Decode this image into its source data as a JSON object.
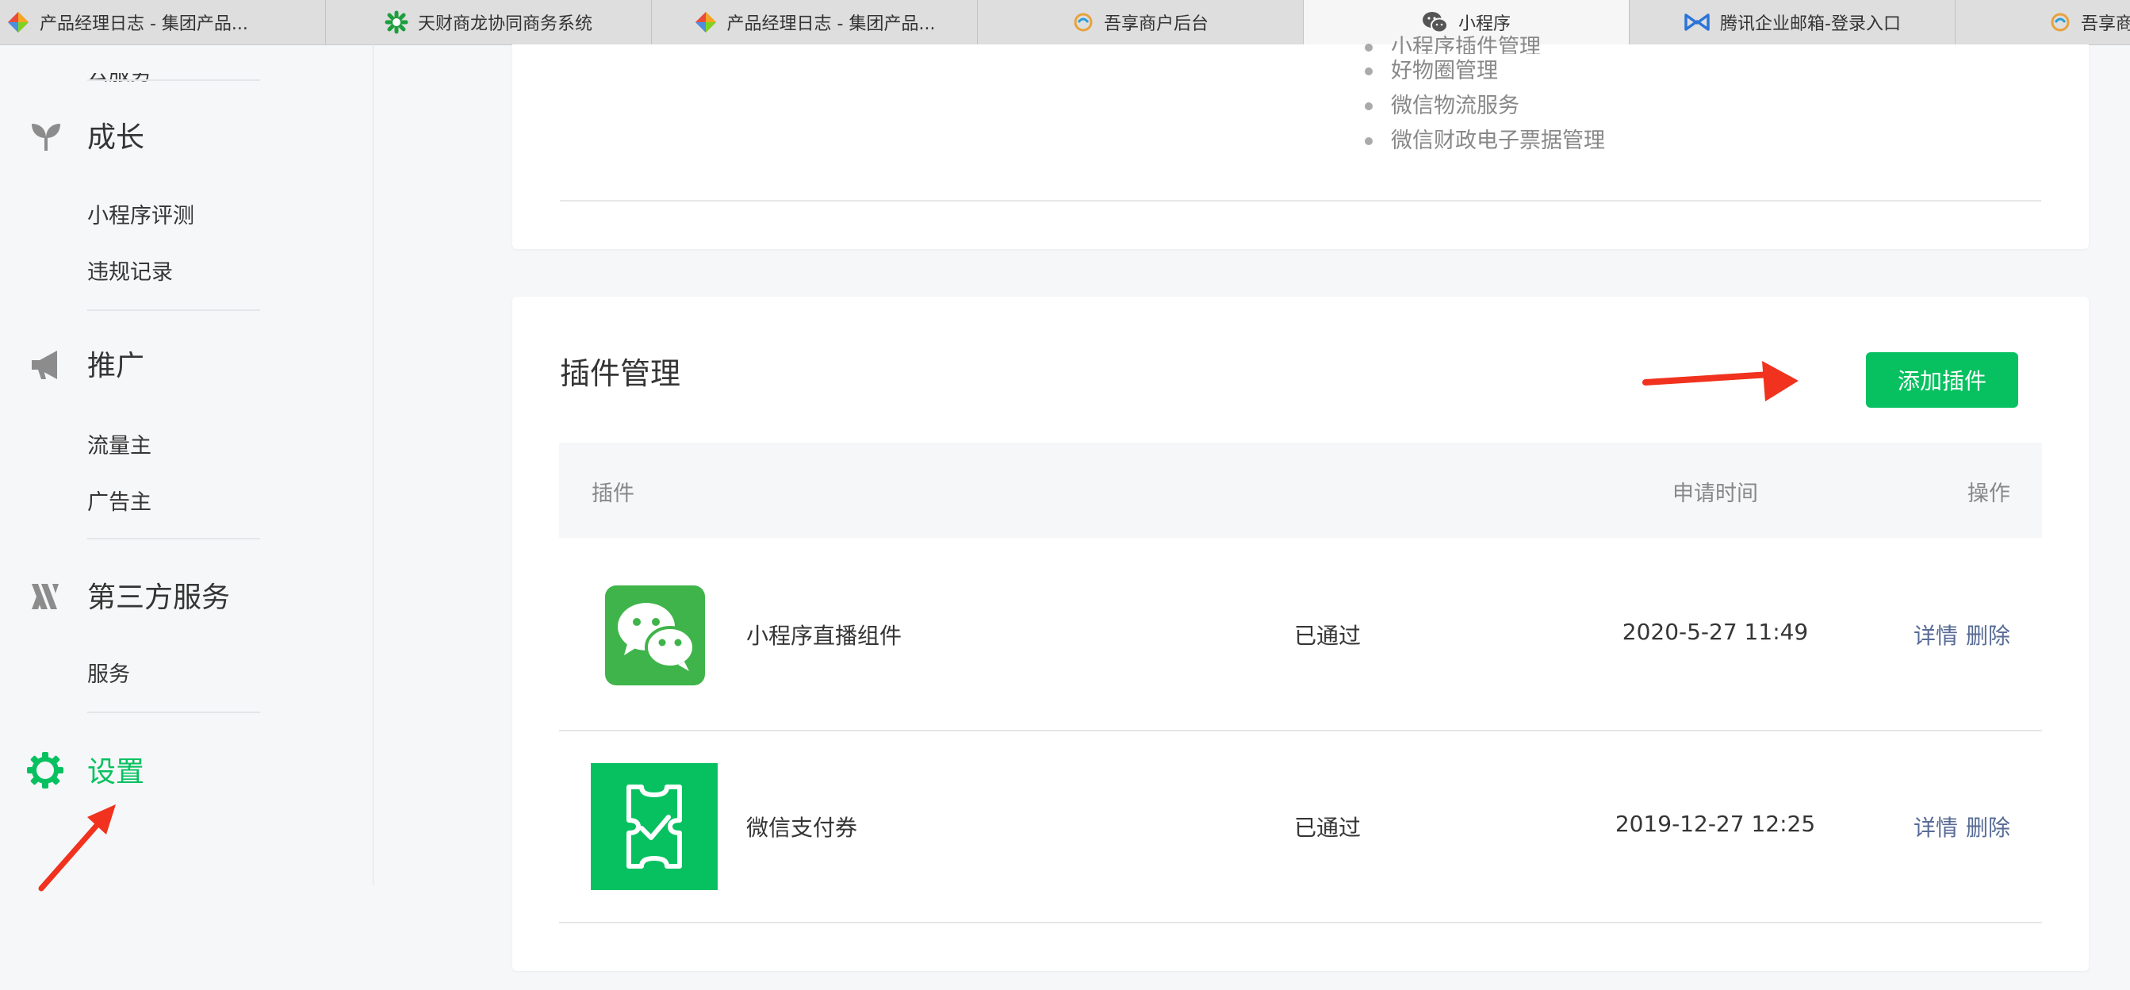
{
  "browser": {
    "tabs": [
      {
        "label": "产品经理日志 - 集团产品...",
        "icon": "colorful-diamond-icon",
        "active": false
      },
      {
        "label": "天财商龙协同商务系统",
        "icon": "green-snowflake-icon",
        "active": false
      },
      {
        "label": "产品经理日志 - 集团产品...",
        "icon": "colorful-diamond-icon",
        "active": false
      },
      {
        "label": "吾享商户后台",
        "icon": "wuxiang-logo-icon",
        "active": false
      },
      {
        "label": "小程序",
        "icon": "wechat-icon",
        "active": true
      },
      {
        "label": "腾讯企业邮箱-登录入口",
        "icon": "tencent-mail-icon",
        "active": false
      },
      {
        "label": "吾享商户后",
        "icon": "wuxiang-logo-icon",
        "active": false
      }
    ]
  },
  "sidebar": {
    "clipped_item": "云服务",
    "sections": [
      {
        "title": "成长",
        "icon": "sprout-icon",
        "items": [
          "小程序评测",
          "违规记录"
        ]
      },
      {
        "title": "推广",
        "icon": "megaphone-icon",
        "items": [
          "流量主",
          "广告主"
        ]
      },
      {
        "title": "第三方服务",
        "icon": "third-party-icon",
        "items": [
          "服务"
        ]
      },
      {
        "title": "设置",
        "icon": "gear-icon",
        "items": [],
        "active": true
      }
    ]
  },
  "top_card": {
    "bullets": [
      "小程序插件管理",
      "好物圈管理",
      "微信物流服务",
      "微信财政电子票据管理"
    ]
  },
  "plugins": {
    "title": "插件管理",
    "add_button": "添加插件",
    "columns": {
      "plugin": "插件",
      "time": "申请时间",
      "action": "操作"
    },
    "rows": [
      {
        "name": "小程序直播组件",
        "status": "已通过",
        "time": "2020-5-27 11:49",
        "icon": "wechat-chat-bubbles-icon",
        "detail": "详情",
        "delete": "删除"
      },
      {
        "name": "微信支付券",
        "status": "已通过",
        "time": "2019-12-27 12:25",
        "icon": "coupon-ticket-icon",
        "detail": "详情",
        "delete": "删除"
      }
    ]
  },
  "colors": {
    "accent": "#07c160",
    "link": "#576b95",
    "annotation_arrow": "#f0321e"
  }
}
